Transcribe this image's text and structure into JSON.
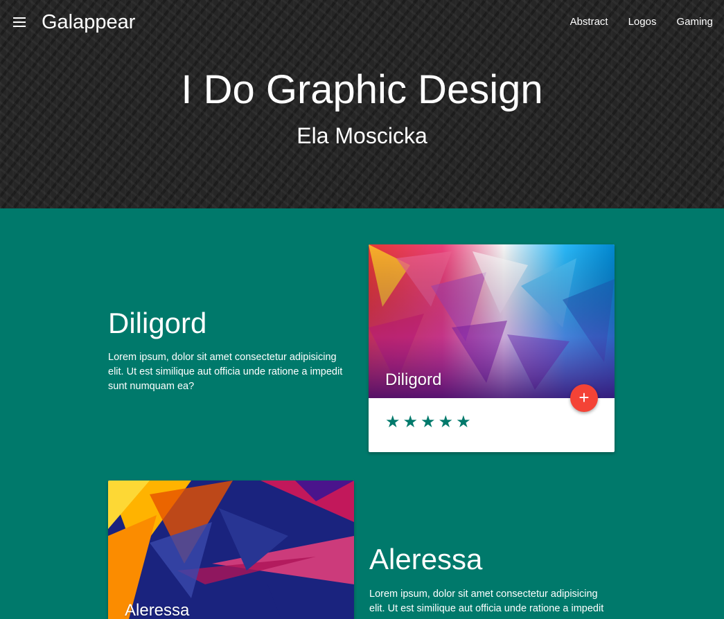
{
  "nav": {
    "brand": "Galappear",
    "links": [
      "Abstract",
      "Logos",
      "Gaming"
    ]
  },
  "hero": {
    "title": "I Do Graphic Design",
    "subtitle": "Ela Moscicka"
  },
  "sections": [
    {
      "heading": "Diligord",
      "text": "Lorem ipsum, dolor sit amet consectetur adipisicing elit. Ut est similique aut officia unde ratione a impedit sunt numquam ea?",
      "card_title": "Diligord",
      "fab_label": "+",
      "rating": 5
    },
    {
      "heading": "Aleressa",
      "text": "Lorem ipsum, dolor sit amet consectetur adipisicing elit. Ut est similique aut officia unde ratione a impedit",
      "card_title": "Aleressa"
    }
  ],
  "colors": {
    "primary": "#00796b",
    "hero_bg": "#262626",
    "fab": "#f44336"
  },
  "icons": {
    "menu": "menu-icon",
    "add": "add-icon",
    "star": "star-icon"
  }
}
